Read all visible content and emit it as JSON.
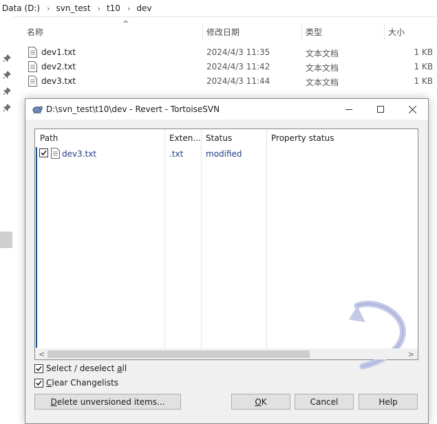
{
  "explorer": {
    "breadcrumb": [
      "Data (D:)",
      "svn_test",
      "t10",
      "dev"
    ],
    "columns": {
      "name": "名称",
      "date": "修改日期",
      "type": "类型",
      "size": "大小"
    },
    "files": [
      {
        "name": "dev1.txt",
        "date": "2024/4/3 11:35",
        "type": "文本文档",
        "size": "1 KB"
      },
      {
        "name": "dev2.txt",
        "date": "2024/4/3 11:42",
        "type": "文本文档",
        "size": "1 KB"
      },
      {
        "name": "dev3.txt",
        "date": "2024/4/3 11:44",
        "type": "文本文档",
        "size": "1 KB"
      }
    ]
  },
  "dialog": {
    "title": "D:\\svn_test\\t10\\dev - Revert - TortoiseSVN",
    "columns": {
      "path": "Path",
      "extension": "Exten...",
      "status": "Status",
      "property_status": "Property status"
    },
    "rows": [
      {
        "path": "dev3.txt",
        "extension": ".txt",
        "status": "modified",
        "property_status": "",
        "checked": true
      }
    ],
    "select_all": {
      "before": "Select / deselect ",
      "key": "a",
      "after": "ll",
      "checked": true
    },
    "clear_changelists": {
      "before": "",
      "key": "C",
      "after": "lear Changelists",
      "checked": true
    },
    "buttons": {
      "delete_unversioned": {
        "key": "D",
        "rest": "elete unversioned items..."
      },
      "ok": {
        "key": "O",
        "rest": "K"
      },
      "cancel": "Cancel",
      "help": "Help"
    },
    "accent_color": "#1f3e8e"
  }
}
